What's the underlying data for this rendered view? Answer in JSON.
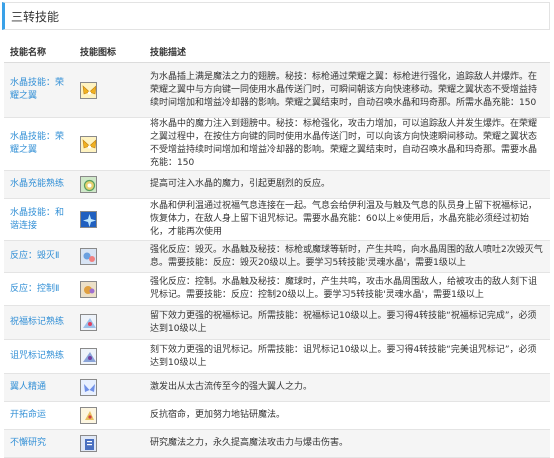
{
  "section": {
    "title": "三转技能"
  },
  "columns": {
    "name": "技能名称",
    "icon": "技能图标",
    "desc": "技能描述"
  },
  "skills": [
    {
      "name": "水晶技能：荣耀之翼",
      "icon": "golden-wings-icon",
      "desc": "为水晶插上满是魔法之力的翅膀。秘技：标枪通过荣耀之翼：标枪进行强化，追踪敌人并爆炸。在荣耀之翼中与方向键一同使用水晶传送门时，可瞬间朝该方向快速移动。荣耀之翼状态不受增益持续时间增加和增益冷却器的影响。荣耀之翼结束时，自动召唤水晶和玛奇那。所需水晶充能：150"
    },
    {
      "name": "水晶技能：荣耀之翼",
      "icon": "golden-wings-icon",
      "desc": "将水晶中的魔力注入到翅膀中。秘技：标枪强化，攻击力增加，可以追踪敌人并发生爆炸。在荣耀之翼过程中，在按住方向键的同时使用水晶传送门时，可以向该方向快速瞬间移动。荣耀之翼状态不受增益持续时间增加和增益冷却器的影响。荣耀之翼结束时，自动召唤水晶和玛奇那。需要水晶充能：150"
    },
    {
      "name": "水晶充能熟练",
      "icon": "crystal-charge-icon",
      "desc": "提高可注入水晶的魔力，引起更剧烈的反应。"
    },
    {
      "name": "水晶技能：和谐连接",
      "icon": "harmony-link-icon",
      "desc": "水晶和伊利温通过祝福气息连接在一起。气息会给伊利温及与触及气息的队员身上留下祝福标记，恢复体力，在敌人身上留下诅咒标记。需要水晶充能：60以上※使用后，水晶充能必须经过初始化，才能再次使用"
    },
    {
      "name": "反应：毁灭Ⅱ",
      "icon": "reaction-destruction-icon",
      "desc": "强化反应：毁灭。水晶触及秘技：标枪或魔球等斩时，产生共鸣，向水晶周围的敌人喷吐2次毁灭气息。需要技能：反应：毁灭20级以上。要学习5转技能'灵魂水晶'，需要1级以上"
    },
    {
      "name": "反应：控制Ⅱ",
      "icon": "reaction-control-icon",
      "desc": "强化反应：控制。水晶触及秘技：魔球时，产生共鸣，攻击水晶周围敌人，给被攻击的敌人刻下诅咒标记。需要技能：反应：控制20级以上。要学习5转技能'灵魂水晶'，需要1级以上"
    },
    {
      "name": "祝福标记熟练",
      "icon": "blessing-mark-icon",
      "desc": "留下效力更强的祝福标记。所需技能：祝福标记10级以上。要习得4转技能“祝福标记完成”，必须达到10级以上"
    },
    {
      "name": "诅咒标记熟练",
      "icon": "curse-mark-icon",
      "desc": "刻下效力更强的诅咒标记。所需技能：诅咒标记10级以上。要习得4转技能“完美诅咒标记”，必须达到10级以上"
    },
    {
      "name": "翼人精通",
      "icon": "wing-mastery-icon",
      "desc": "激发出从太古流传至今的强大翼人之力。"
    },
    {
      "name": "开拓命运",
      "icon": "open-fate-icon",
      "desc": "反抗宿命，更加努力地钻研魔法。"
    },
    {
      "name": "不懈研究",
      "icon": "research-icon",
      "desc": "研究魔法之力，永久提高魔法攻击力与爆击伤害。"
    }
  ]
}
